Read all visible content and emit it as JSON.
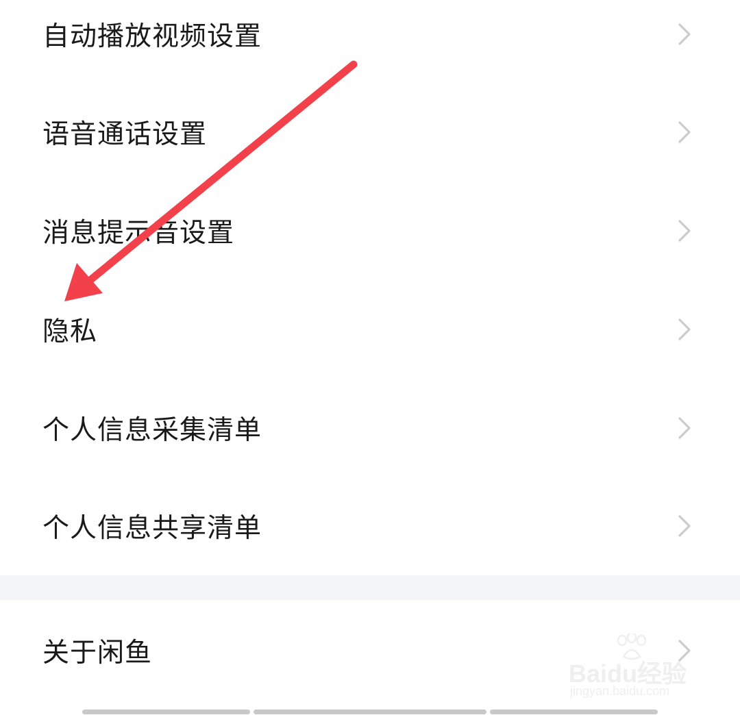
{
  "settings": {
    "items": [
      {
        "label": "自动播放视频设置",
        "icon": "chevron-right-icon"
      },
      {
        "label": "语音通话设置",
        "icon": "chevron-right-icon"
      },
      {
        "label": "消息提示音设置",
        "icon": "chevron-right-icon"
      },
      {
        "label": "隐私",
        "icon": "chevron-right-icon"
      },
      {
        "label": "个人信息采集清单",
        "icon": "chevron-right-icon"
      },
      {
        "label": "个人信息共享清单",
        "icon": "chevron-right-icon"
      }
    ],
    "about": {
      "label": "关于闲鱼",
      "icon": "chevron-right-icon"
    }
  },
  "annotation": {
    "type": "arrow",
    "color": "#f2414b",
    "points_to": "隐私"
  },
  "watermark": {
    "main": "Baidu经验",
    "sub": "jingyan.baidu.com",
    "icon": "paw-icon"
  },
  "colors": {
    "text": "#1a1a1a",
    "chevron": "#cccccc",
    "separator": "#f4f5f8",
    "background": "#ffffff"
  }
}
